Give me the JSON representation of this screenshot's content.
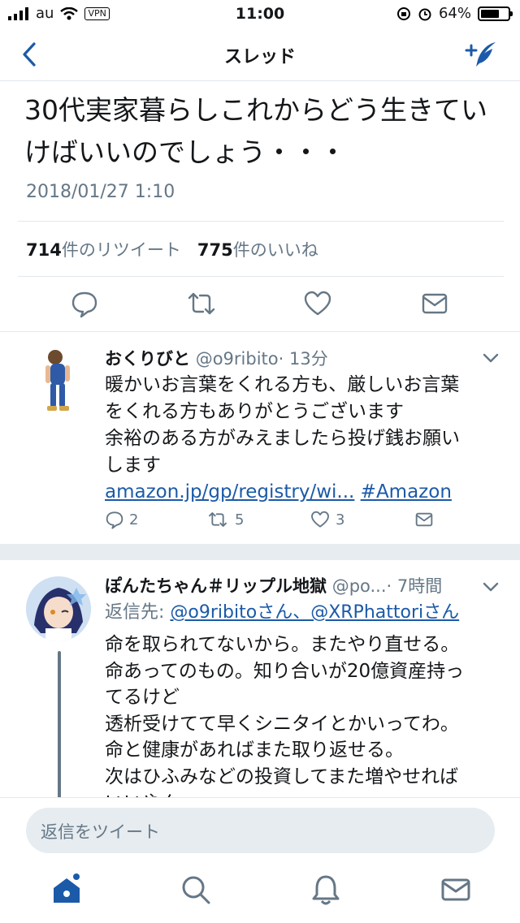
{
  "status_bar": {
    "carrier": "au",
    "vpn": "VPN",
    "time": "11:00",
    "battery": "64%",
    "battery_level": 0.64
  },
  "nav": {
    "title": "スレッド",
    "back_icon": "chevron-left-icon",
    "compose_icon": "compose-tweet-icon"
  },
  "main_tweet": {
    "text": "30代実家暮らしこれからどう生きていけばいいのでしょう・・・",
    "date": "2018/01/27 1:10",
    "retweet_count": "714",
    "retweet_label": "件のリツイート",
    "like_count": "775",
    "like_label": "件のいいね"
  },
  "reply1": {
    "name": "おくりびと",
    "handle": "@o9ribito",
    "time": "· 13分",
    "lines": [
      "暖かいお言葉をくれる方も、厳しいお言葉",
      "をくれる方もありがとうございます",
      "余裕のある方がみえましたら投げ銭お願い",
      "します"
    ],
    "link": "amazon.jp/gp/registry/wi...",
    "hashtag": "#Amazon",
    "reply_count": "2",
    "retweet_count": "5",
    "like_count": "3"
  },
  "reply2": {
    "name": "ぽんたちゃん＃リップル地獄",
    "handle": "@po...",
    "time": "· 7時間",
    "reply_to_label": "返信先:",
    "reply_to": "@o9ribitoさん、@XRPhattoriさん",
    "lines": [
      "命を取られてないから。またやり直せる。",
      "命あってのもの。知り合いが20億資産持っ",
      "てるけど",
      "透析受けてて早くシニタイとかいってわ。",
      "命と健康があればまた取り返せる。",
      "次はひふみなどの投資してまた増やせれば",
      "いいやん"
    ]
  },
  "reply_box": {
    "placeholder": "返信をツイート"
  },
  "tabs": [
    "home-icon",
    "search-icon",
    "notifications-icon",
    "messages-icon"
  ],
  "colors": {
    "accent": "#1b5aa8",
    "secondary_text": "#657786",
    "divider": "#e1e8ed"
  }
}
